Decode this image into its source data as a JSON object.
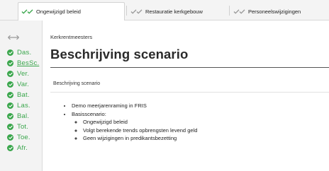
{
  "tabs": [
    {
      "label": "Ongewijzigd beleid",
      "active": true
    },
    {
      "label": "Restauratie kerkgebouw",
      "active": false
    },
    {
      "label": "Personeelswijzigingen",
      "active": false
    }
  ],
  "colors": {
    "check_green": "#3aa64c",
    "check_grey": "#9a9a9a"
  },
  "sidebar": {
    "items": [
      {
        "label": "Das."
      },
      {
        "label": "BesSc."
      },
      {
        "label": "Ver."
      },
      {
        "label": "Var."
      },
      {
        "label": "Bat."
      },
      {
        "label": "Las."
      },
      {
        "label": "Bal."
      },
      {
        "label": "Tot."
      },
      {
        "label": "Toe."
      },
      {
        "label": "Afr."
      }
    ]
  },
  "main": {
    "breadcrumb": "Kerkrentmeesters",
    "title": "Beschrijving scenario",
    "section_label": "Beschrijving scenario",
    "bullets": {
      "item1": "Demo meerjarenraming in FRIS",
      "item2": "Basisscenario:",
      "sub": [
        "Ongewijzigd beleid",
        "Volgt berekende trends opbrengsten levend geld",
        "Geen wijzigingen in predikantsbezetting"
      ]
    }
  }
}
